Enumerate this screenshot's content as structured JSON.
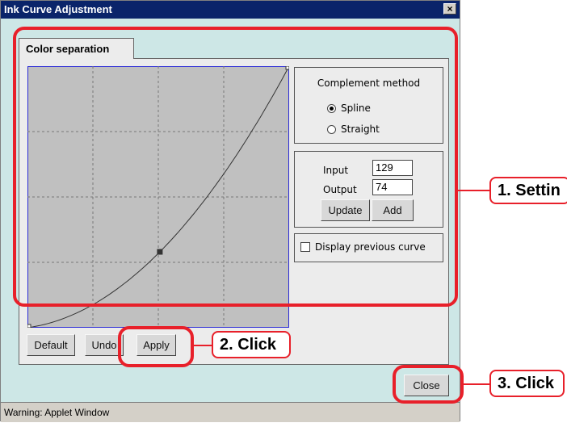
{
  "window": {
    "title": "Ink Curve Adjustment",
    "close_glyph": "×"
  },
  "tab": {
    "label": "Color separation"
  },
  "curve": {
    "control_point": {
      "input": 129,
      "output": 74
    }
  },
  "complement": {
    "title": "Complement method",
    "options": [
      {
        "label": "Spline",
        "selected": true
      },
      {
        "label": "Straight",
        "selected": false
      }
    ]
  },
  "point_editor": {
    "input_label": "Input",
    "input_value": "129",
    "output_label": "Output",
    "output_value": "74",
    "update_label": "Update",
    "add_label": "Add"
  },
  "display_previous": {
    "label": "Display previous curve",
    "checked": false
  },
  "buttons": {
    "default_label": "Default",
    "undo_label": "Undo",
    "apply_label": "Apply",
    "close_label": "Close"
  },
  "status": {
    "text": "Warning: Applet Window"
  },
  "annotations": {
    "callout1": "1. Settin",
    "callout2": "2. Click",
    "callout3": "3. Click",
    "color": "#e8202a"
  }
}
